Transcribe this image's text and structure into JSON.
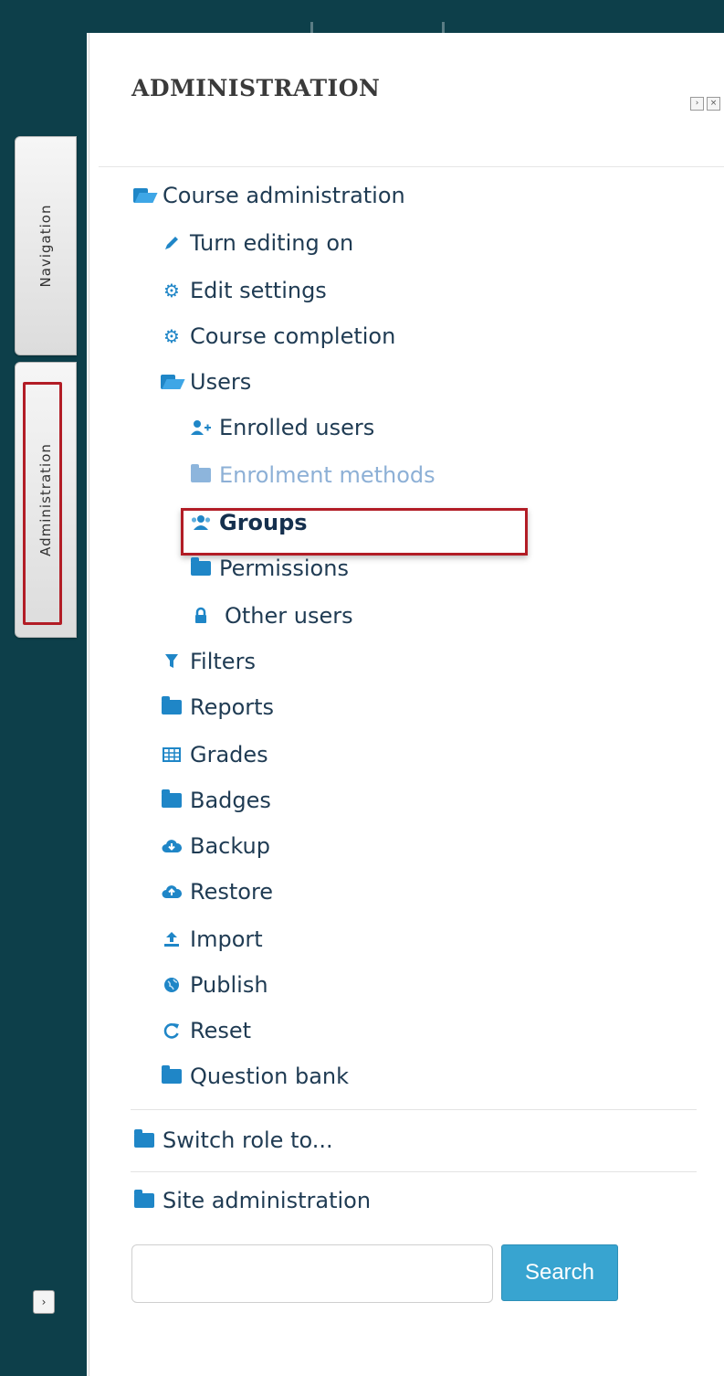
{
  "tabs": {
    "navigation": "Navigation",
    "administration": "Administration"
  },
  "panel": {
    "title": "ADMINISTRATION"
  },
  "tree": {
    "course_admin": "Course administration",
    "turn_editing": "Turn editing on",
    "edit_settings": "Edit settings",
    "course_completion": "Course completion",
    "users": "Users",
    "enrolled_users": "Enrolled users",
    "enrolment_methods": "Enrolment methods",
    "groups": "Groups",
    "permissions": "Permissions",
    "other_users": "Other users",
    "filters": "Filters",
    "reports": "Reports",
    "grades": "Grades",
    "badges": "Badges",
    "backup": "Backup",
    "restore": "Restore",
    "import": "Import",
    "publish": "Publish",
    "reset": "Reset",
    "question_bank": "Question bank",
    "switch_role": "Switch role to...",
    "site_admin": "Site administration"
  },
  "search": {
    "button": "Search",
    "placeholder": ""
  },
  "colors": {
    "rail": "#0d3f4a",
    "link": "#1f3b53",
    "icon": "#1f86c7",
    "highlight": "#b21d26",
    "button": "#38a4d0"
  },
  "icons": [
    "folder-open-icon",
    "pencil-icon",
    "cogs-icon",
    "user-plus-icon",
    "folder-icon",
    "users-icon",
    "lock-icon",
    "filter-icon",
    "table-icon",
    "cloud-download-icon",
    "cloud-upload-icon",
    "upload-icon",
    "globe-icon",
    "refresh-icon"
  ]
}
